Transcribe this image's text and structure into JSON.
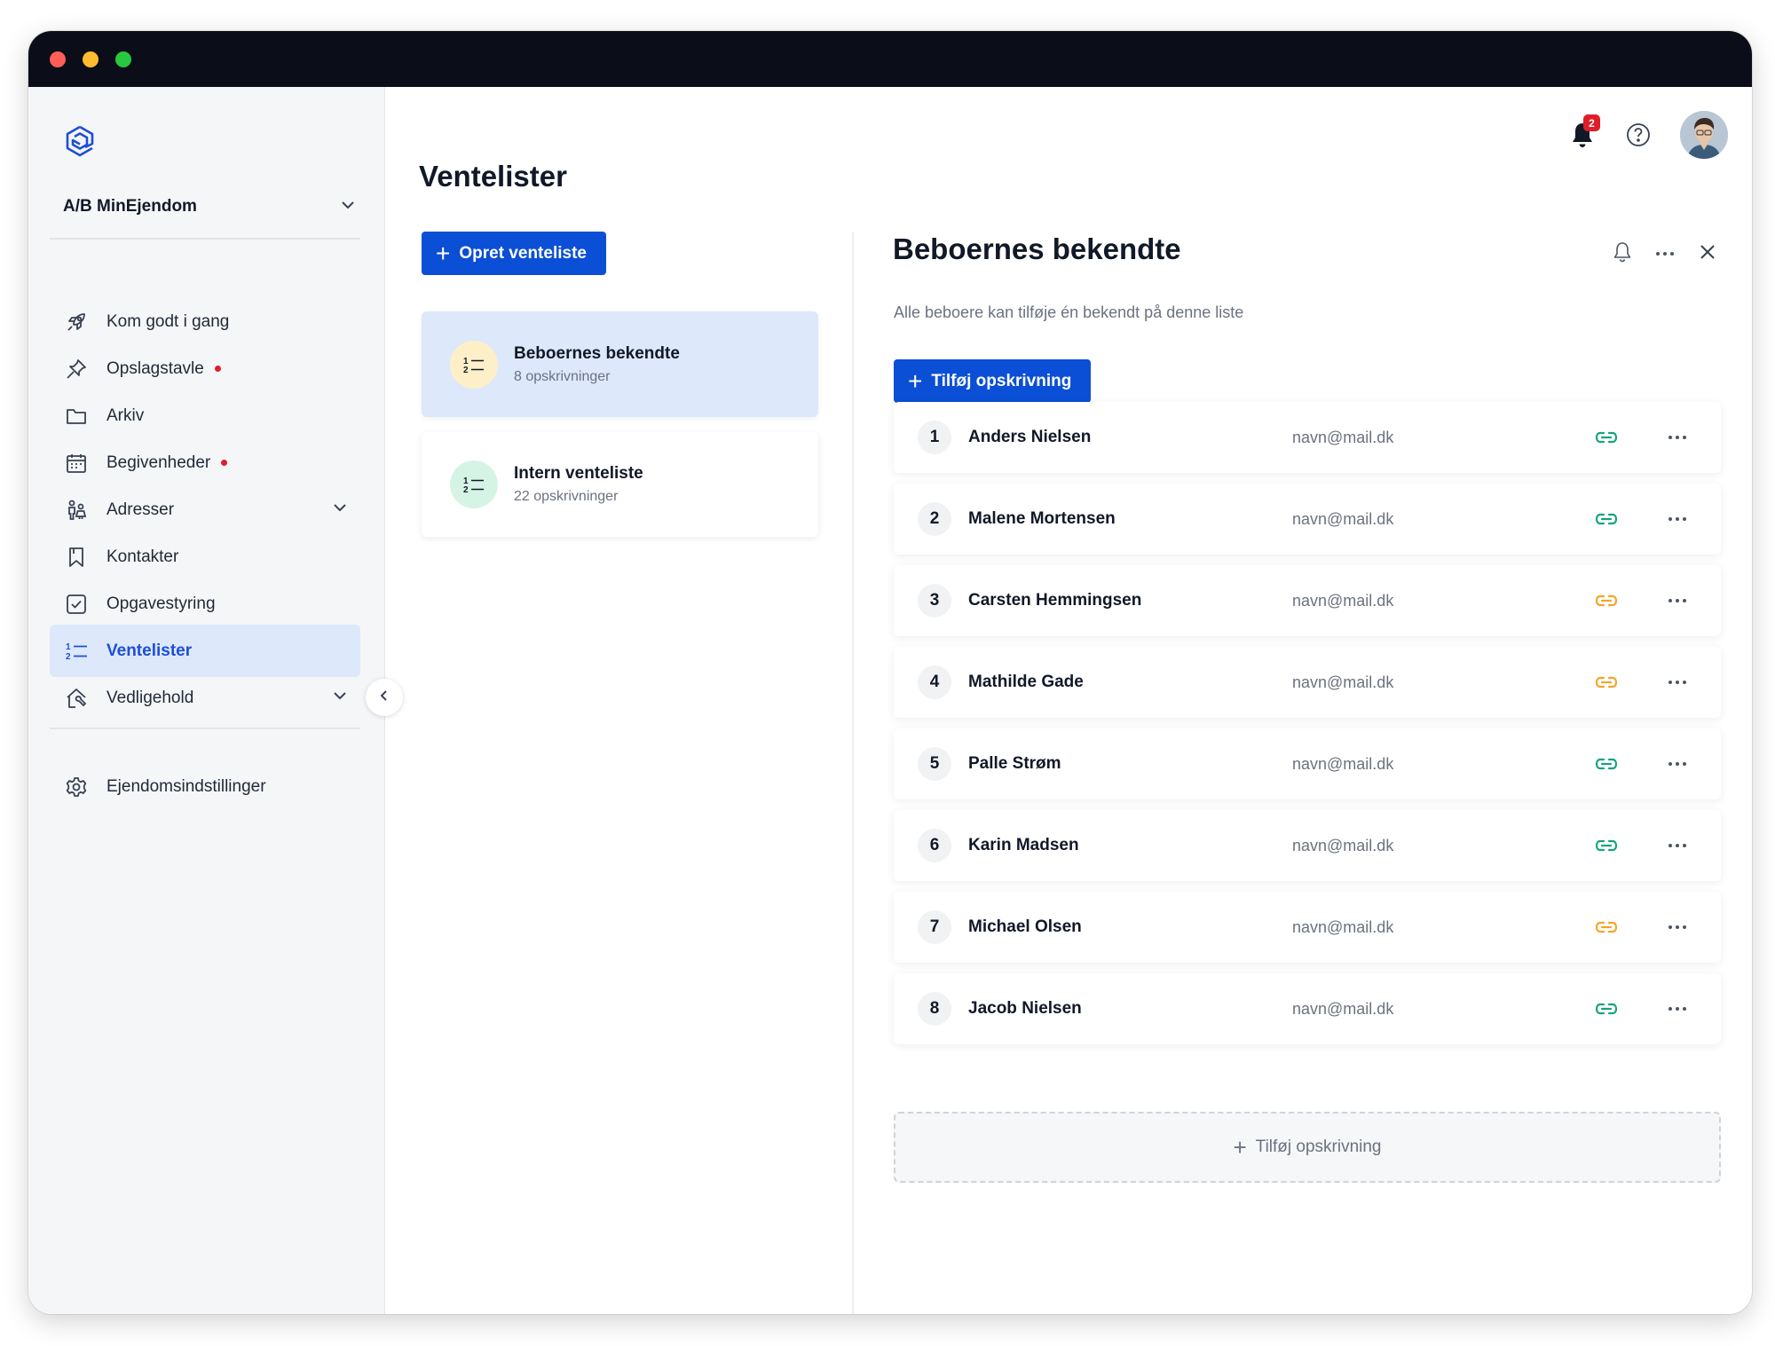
{
  "sidebar": {
    "org_name": "A/B MinEjendom",
    "items": [
      {
        "label": "Kom godt i gang",
        "icon": "rocket-icon"
      },
      {
        "label": "Opslagstavle",
        "icon": "pin-icon",
        "dot": true
      },
      {
        "label": "Arkiv",
        "icon": "folder-icon"
      },
      {
        "label": "Begivenheder",
        "icon": "calendar-icon",
        "dot": true
      },
      {
        "label": "Adresser",
        "icon": "people-icon",
        "expandable": true
      },
      {
        "label": "Kontakter",
        "icon": "bookmark-icon"
      },
      {
        "label": "Opgavestyring",
        "icon": "checkbox-icon"
      },
      {
        "label": "Ventelister",
        "icon": "numbered-list-icon",
        "active": true
      },
      {
        "label": "Vedligehold",
        "icon": "maintenance-icon",
        "expandable": true
      }
    ],
    "settings_label": "Ejendomsindstillinger"
  },
  "header": {
    "notification_count": "2"
  },
  "main": {
    "title": "Ventelister",
    "create_button": "Opret venteliste",
    "lists": [
      {
        "title": "Beboernes bekendte",
        "subtitle": "8 opskrivninger",
        "selected": true,
        "icon_bg": "#fdf0c8"
      },
      {
        "title": "Intern venteliste",
        "subtitle": "22 opskrivninger",
        "selected": false,
        "icon_bg": "#d6f4e6"
      }
    ]
  },
  "detail": {
    "title": "Beboernes bekendte",
    "description": "Alle beboere kan tilføje én bekendt på denne liste",
    "add_button": "Tilføj opskrivning",
    "add_row_label": "Tilføj opskrivning",
    "entries": [
      {
        "num": "1",
        "name": "Anders Nielsen",
        "email": "navn@mail.dk",
        "link_color": "#14a37f"
      },
      {
        "num": "2",
        "name": "Malene Mortensen",
        "email": "navn@mail.dk",
        "link_color": "#14a37f"
      },
      {
        "num": "3",
        "name": "Carsten Hemmingsen",
        "email": "navn@mail.dk",
        "link_color": "#f5a524"
      },
      {
        "num": "4",
        "name": "Mathilde Gade",
        "email": "navn@mail.dk",
        "link_color": "#f5a524"
      },
      {
        "num": "5",
        "name": "Palle Strøm",
        "email": "navn@mail.dk",
        "link_color": "#14a37f"
      },
      {
        "num": "6",
        "name": "Karin Madsen",
        "email": "navn@mail.dk",
        "link_color": "#14a37f"
      },
      {
        "num": "7",
        "name": "Michael Olsen",
        "email": "navn@mail.dk",
        "link_color": "#f5a524"
      },
      {
        "num": "8",
        "name": "Jacob Nielsen",
        "email": "navn@mail.dk",
        "link_color": "#14a37f"
      }
    ]
  },
  "colors": {
    "accent": "#0b4fd6",
    "active_nav_bg": "#dde8fb",
    "notification_dot": "#e11d2a"
  }
}
